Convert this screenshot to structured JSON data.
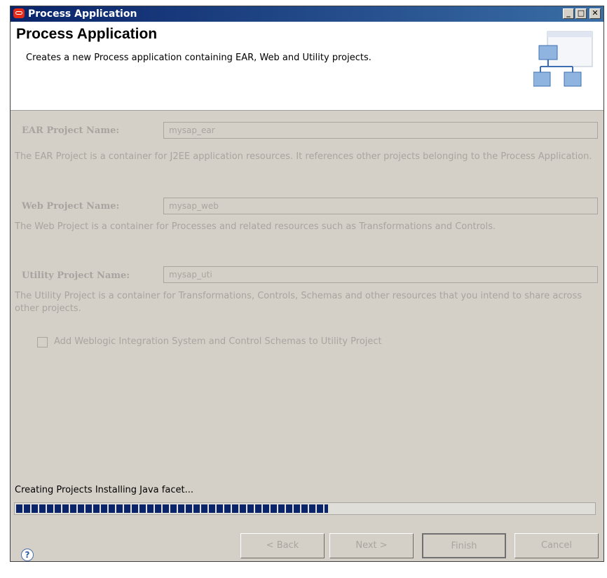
{
  "window": {
    "title": "Process Application",
    "buttons": {
      "minimize": "_",
      "maximize": "□",
      "close": "✕"
    }
  },
  "header": {
    "title": "Process Application",
    "description": "Creates a new Process application containing EAR, Web and Utility projects."
  },
  "ear": {
    "label": "EAR Project Name:",
    "value": "mysap_ear",
    "description": "The EAR Project is a container for J2EE application resources.  It references other projects belonging to the Process Application."
  },
  "web": {
    "label": "Web Project Name:",
    "value": "mysap_web",
    "description": "The Web Project is a container for Processes and related resources such as Transformations and Controls."
  },
  "utility": {
    "label": "Utility Project Name:",
    "value": "mysap_uti",
    "description": "The Utility Project is a container for Transformations, Controls, Schemas and other resources that you intend to share across other projects."
  },
  "option": {
    "label": "Add Weblogic Integration System and Control Schemas to Utility Project",
    "checked": false
  },
  "status": {
    "text": "Creating Projects Installing Java facet...",
    "progress": 0.54
  },
  "footer": {
    "help": "?",
    "back": "< Back",
    "next": "Next >",
    "finish": "Finish",
    "cancel": "Cancel"
  }
}
